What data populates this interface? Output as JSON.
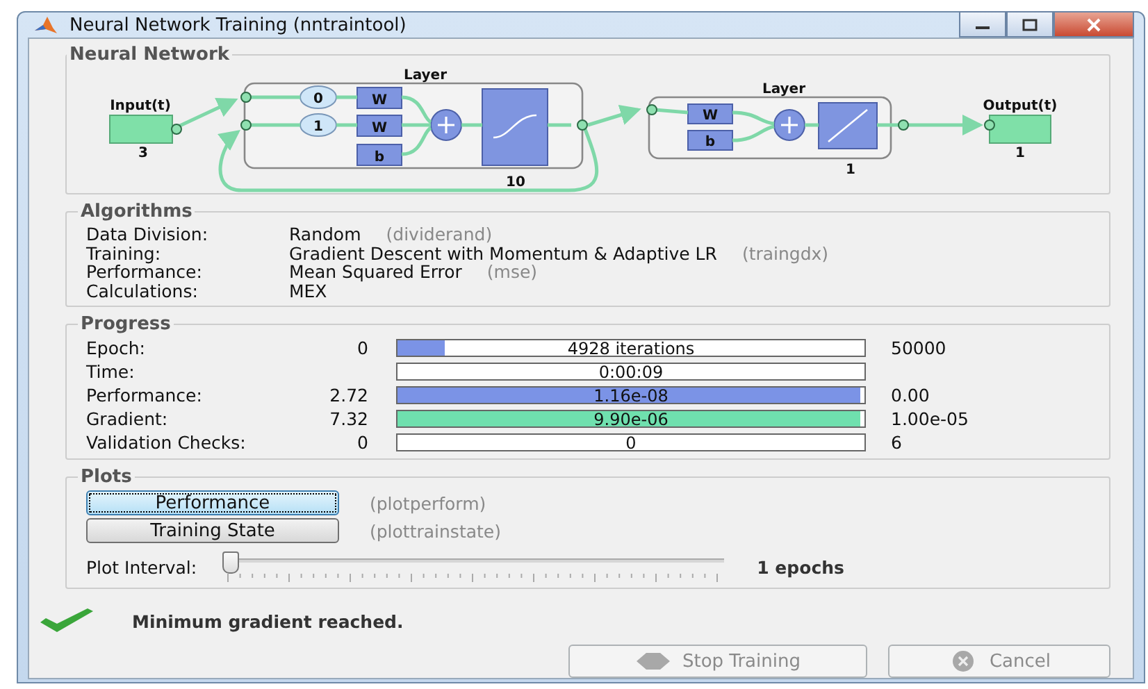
{
  "window": {
    "title": "Neural Network Training (nntraintool)"
  },
  "network": {
    "title": "Neural Network",
    "input": {
      "label": "Input(t)",
      "size": "3"
    },
    "layers": [
      {
        "title": "Layer",
        "size": "10",
        "delays": [
          "0",
          "1"
        ],
        "weights": [
          "W",
          "W"
        ],
        "bias": "b",
        "kind": "sigmoid"
      },
      {
        "title": "Layer",
        "size": "1",
        "weights": [
          "W"
        ],
        "bias": "b",
        "kind": "linear"
      }
    ],
    "output": {
      "label": "Output(t)",
      "size": "1"
    }
  },
  "algorithms": {
    "title": "Algorithms",
    "rows": [
      {
        "label": "Data Division:",
        "value": "Random",
        "function": "(dividerand)"
      },
      {
        "label": "Training:",
        "value": "Gradient Descent with Momentum & Adaptive LR",
        "function": "(traingdx)"
      },
      {
        "label": "Performance:",
        "value": "Mean Squared Error",
        "function": "(mse)"
      },
      {
        "label": "Calculations:",
        "value": "MEX"
      }
    ]
  },
  "progress": {
    "title": "Progress",
    "rows": [
      {
        "label": "Epoch:",
        "start": "0",
        "reading": "4928 iterations",
        "end": "50000",
        "level": 0.1,
        "color": "#7b93e6"
      },
      {
        "label": "Time:",
        "reading": "0:00:09"
      },
      {
        "label": "Performance:",
        "start": "2.72",
        "reading": "1.16e-08",
        "end": "0.00",
        "level": 0.99,
        "color": "#7b93e6"
      },
      {
        "label": "Gradient:",
        "start": "7.32",
        "reading": "9.90e-06",
        "end": "1.00e-05",
        "level": 0.99,
        "color": "#6fe0ae"
      },
      {
        "label": "Validation Checks:",
        "start": "0",
        "reading": "0",
        "end": "6"
      }
    ]
  },
  "plots": {
    "title": "Plots",
    "buttons": [
      {
        "label": "Performance",
        "function": "(plotperform)",
        "focused": true
      },
      {
        "label": "Training State",
        "function": "(plottrainstate)",
        "focused": false
      }
    ],
    "interval": {
      "label": "Plot Interval:",
      "level": 0,
      "reading": "1 epochs"
    }
  },
  "status": {
    "text": "Minimum gradient reached."
  },
  "actions": [
    {
      "kind": "stop",
      "label": "Stop Training",
      "disabled": true
    },
    {
      "kind": "cancel",
      "label": "Cancel",
      "disabled": true
    }
  ]
}
